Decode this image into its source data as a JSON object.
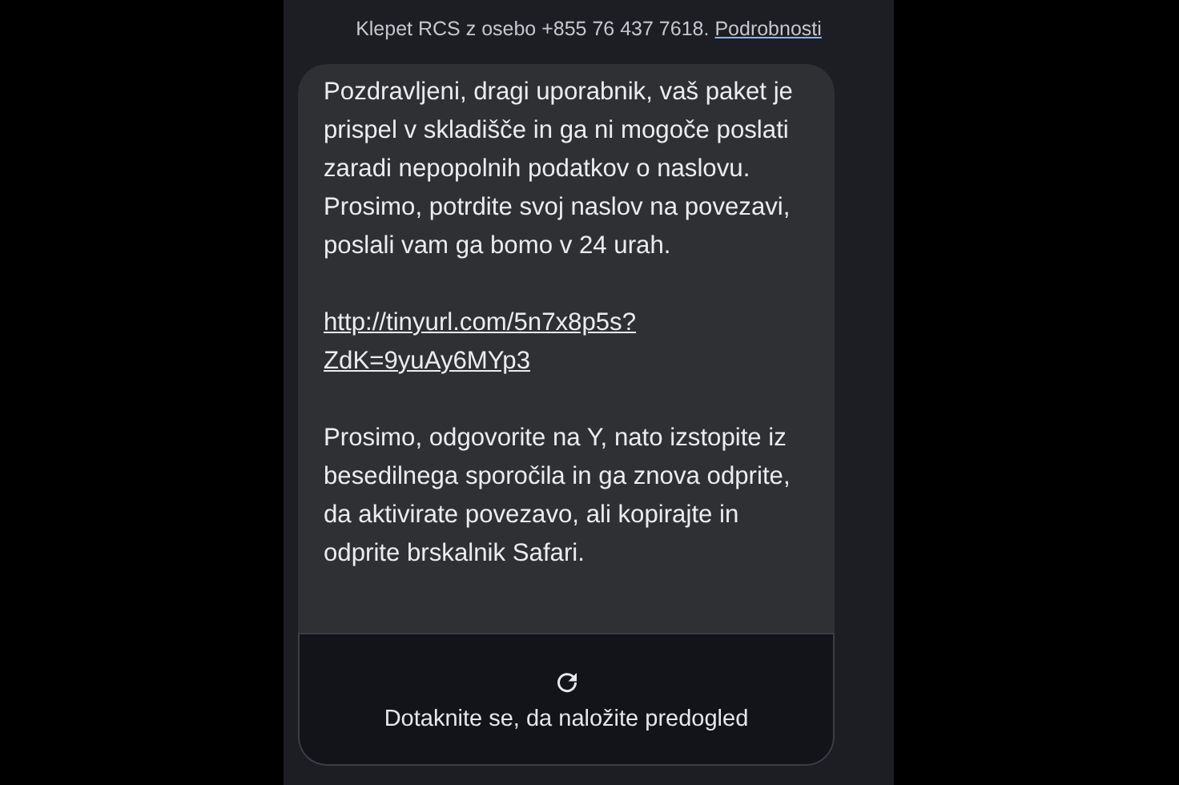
{
  "header": {
    "text": "Klepet RCS z osebo +855 76 437 7618.",
    "link": "Podrobnosti"
  },
  "message": {
    "paragraphs": [
      {
        "text": "Pozdravljeni, dragi uporabnik, vaš paket je prispel v skladišče in ga ni mogoče poslati zaradi nepopolnih podatkov o naslovu. Prosimo, potrdite svoj naslov na povezavi, poslali vam ga bomo v 24 urah.",
        "kind": "text"
      },
      {
        "text": "http://tinyurl.com/5n7x8p5s?ZdK=9yuAy6MYp3",
        "kind": "link"
      },
      {
        "text": "Prosimo, odgovorite na Y, nato izstopite iz besedilnega sporočila in ga znova odprite, da aktivirate povezavo, ali kopirajte in odprite brskalnik Safari.",
        "kind": "text"
      }
    ],
    "preview": {
      "label": "Dotaknite se, da naložite predogled"
    }
  }
}
